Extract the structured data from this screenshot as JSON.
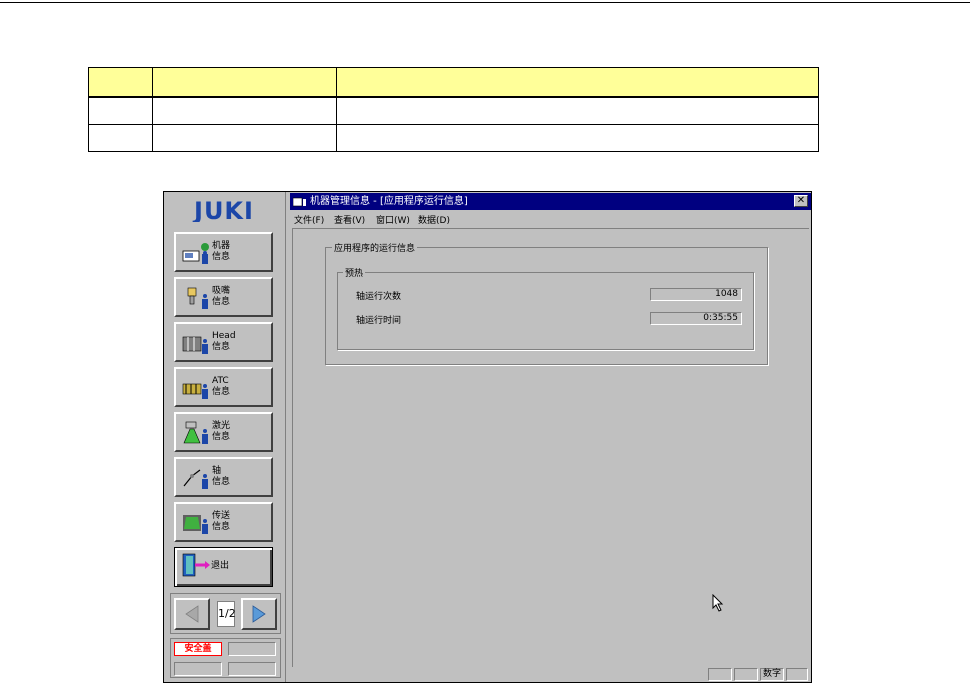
{
  "logo_text": "JUKI",
  "sidebar": {
    "buttons": [
      {
        "line1": "机器",
        "line2": "信息",
        "icon": "machine-info-icon"
      },
      {
        "line1": "吸嘴",
        "line2": "信息",
        "icon": "nozzle-info-icon"
      },
      {
        "line1": "Head",
        "line2": "信息",
        "icon": "head-info-icon"
      },
      {
        "line1": "ATC",
        "line2": "信息",
        "icon": "atc-info-icon"
      },
      {
        "line1": "激光",
        "line2": "信息",
        "icon": "laser-info-icon"
      },
      {
        "line1": "轴",
        "line2": "信息",
        "icon": "axis-info-icon"
      },
      {
        "line1": "传送",
        "line2": "信息",
        "icon": "conveyor-info-icon"
      }
    ],
    "exit_label": "退出",
    "page_indicator": "1/2",
    "safety_label": "安全盖"
  },
  "window": {
    "title": "机器管理信息 - [应用程序运行信息]",
    "close_glyph": "✕",
    "menu": [
      "文件(F)",
      "查看(V)",
      "窗口(W)",
      "数据(D)"
    ],
    "group_title": "应用程序的运行信息",
    "subgroup_title": "预热",
    "rows": [
      {
        "label": "轴运行次数",
        "value": "1048"
      },
      {
        "label": "轴运行时间",
        "value": "0:35:55"
      }
    ],
    "status_num": "数字"
  },
  "colors": {
    "face": "#c0c0c0",
    "titlebar": "#000080",
    "table_header": "#ffff99",
    "safety": "#ff0000"
  }
}
